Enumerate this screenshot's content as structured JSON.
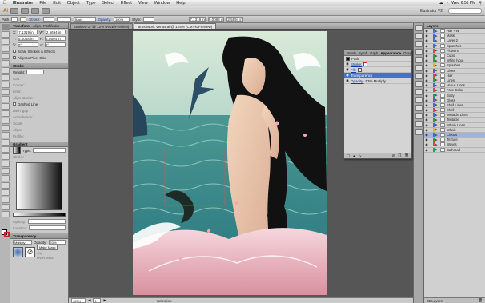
{
  "menubar": {
    "app": "Illustrator",
    "items": [
      "File",
      "Edit",
      "Object",
      "Type",
      "Select",
      "Effect",
      "View",
      "Window",
      "Help"
    ],
    "clock": "Wed 6:56 PM"
  },
  "appbar": {
    "workspace": "Illustrator V2"
  },
  "control": {
    "label": "Path",
    "stroke_label": "Stroke:",
    "basic": "Basic",
    "opacity_label": "Opacity:",
    "opacity": "100%",
    "style_label": "Style:",
    "x": "7.1319 in",
    "y": "9.0088 in",
    "w": "2.5694 in"
  },
  "transform": {
    "tabs": [
      "Transform",
      "Align",
      "Pathfinder"
    ],
    "x": "7.1319 in",
    "w": "2.5694 in",
    "y": "8.0088 in",
    "h": "2.5694 in",
    "rot": "0°",
    "shear": "0°",
    "opt1": "Scale Strokes & Effects",
    "opt2": "Align to Pixel Grid"
  },
  "stroke": {
    "title": "Stroke",
    "weight": "Weight:",
    "cap": "Cap:",
    "corner": "Corner:",
    "limit": "Limit:",
    "align": "Align Stroke:",
    "dashed": "Dashed Line",
    "dash": "dash",
    "gap": "gap",
    "arrowheads": "Arrowheads:",
    "scale": "Scale:",
    "align2": "Align:",
    "profile": "Profile:"
  },
  "gradient": {
    "title": "Gradient",
    "type": "Type:",
    "stroke": "Stroke:",
    "opacity": "Opacity:",
    "location": "Location:"
  },
  "transparency": {
    "title": "Transparency",
    "mode": "Multiply",
    "opacity_label": "Opacity:",
    "opacity": "53%",
    "make_mask": "Make Mask",
    "clip": "Clip",
    "invert": "Invert Mask"
  },
  "doctabs": [
    {
      "label": "Untitled-1* @ 12% (RGB/Preview)",
      "active": false
    },
    {
      "label": "Brushwork Venus.ai @ 125% (CMYK/Preview)",
      "active": true
    }
  ],
  "status": {
    "zoom": "125%",
    "page": "1",
    "tool": "Selection"
  },
  "appearance": {
    "tabs": [
      "Brush",
      "Symb",
      "Grph",
      "Appearance",
      "Graphic",
      "Grad"
    ],
    "title": "Path",
    "stroke_label": "Stroke:",
    "fill_label": "Fill:",
    "transp_label": "Transparency",
    "opacity_label": "Opacity:",
    "opacity_value": "53% Multiply"
  },
  "layers": {
    "title": "Layers",
    "items": [
      {
        "name": "Hair VW",
        "color": "#3d6fd1"
      },
      {
        "name": "Mask",
        "color": "#3d6fd1"
      },
      {
        "name": "Layer 2",
        "color": "#3d6fd1"
      },
      {
        "name": "Splatches",
        "color": "#3d6fd1"
      },
      {
        "name": "Flowers",
        "color": "#e14545"
      },
      {
        "name": "Cupid",
        "color": "#2f9d3b"
      },
      {
        "name": "White (you)",
        "color": "#2f9d3b"
      },
      {
        "name": "Splashes",
        "color": "#d4b63b"
      },
      {
        "name": "Gloss",
        "color": "#7a4bd1"
      },
      {
        "name": "Hair",
        "color": "#e14545"
      },
      {
        "name": "Lines",
        "color": "#2f9d3b"
      },
      {
        "name": "Venus Lines",
        "color": "#3d6fd1"
      },
      {
        "name": "Face Color",
        "color": "#e14545"
      },
      {
        "name": "Body",
        "color": "#2f9d3b"
      },
      {
        "name": "Gloss",
        "color": "#7a4bd1"
      },
      {
        "name": "Shell Lines",
        "color": "#3d6fd1"
      },
      {
        "name": "Shell",
        "color": "#e14545"
      },
      {
        "name": "Tentacle Lines",
        "color": "#3d6fd1"
      },
      {
        "name": "Tentacle",
        "color": "#2f9d3b"
      },
      {
        "name": "Whale Lines",
        "color": "#3d6fd1"
      },
      {
        "name": "Whale",
        "color": "#d4b63b"
      },
      {
        "name": "Clouds",
        "color": "#3d6fd1"
      },
      {
        "name": "Texture",
        "color": "#2f9d3b"
      },
      {
        "name": "Waves",
        "color": "#e14545"
      },
      {
        "name": "Bathroad",
        "color": "#2f9d3b"
      }
    ],
    "selected_index": 21,
    "footer": "25 Layers"
  }
}
